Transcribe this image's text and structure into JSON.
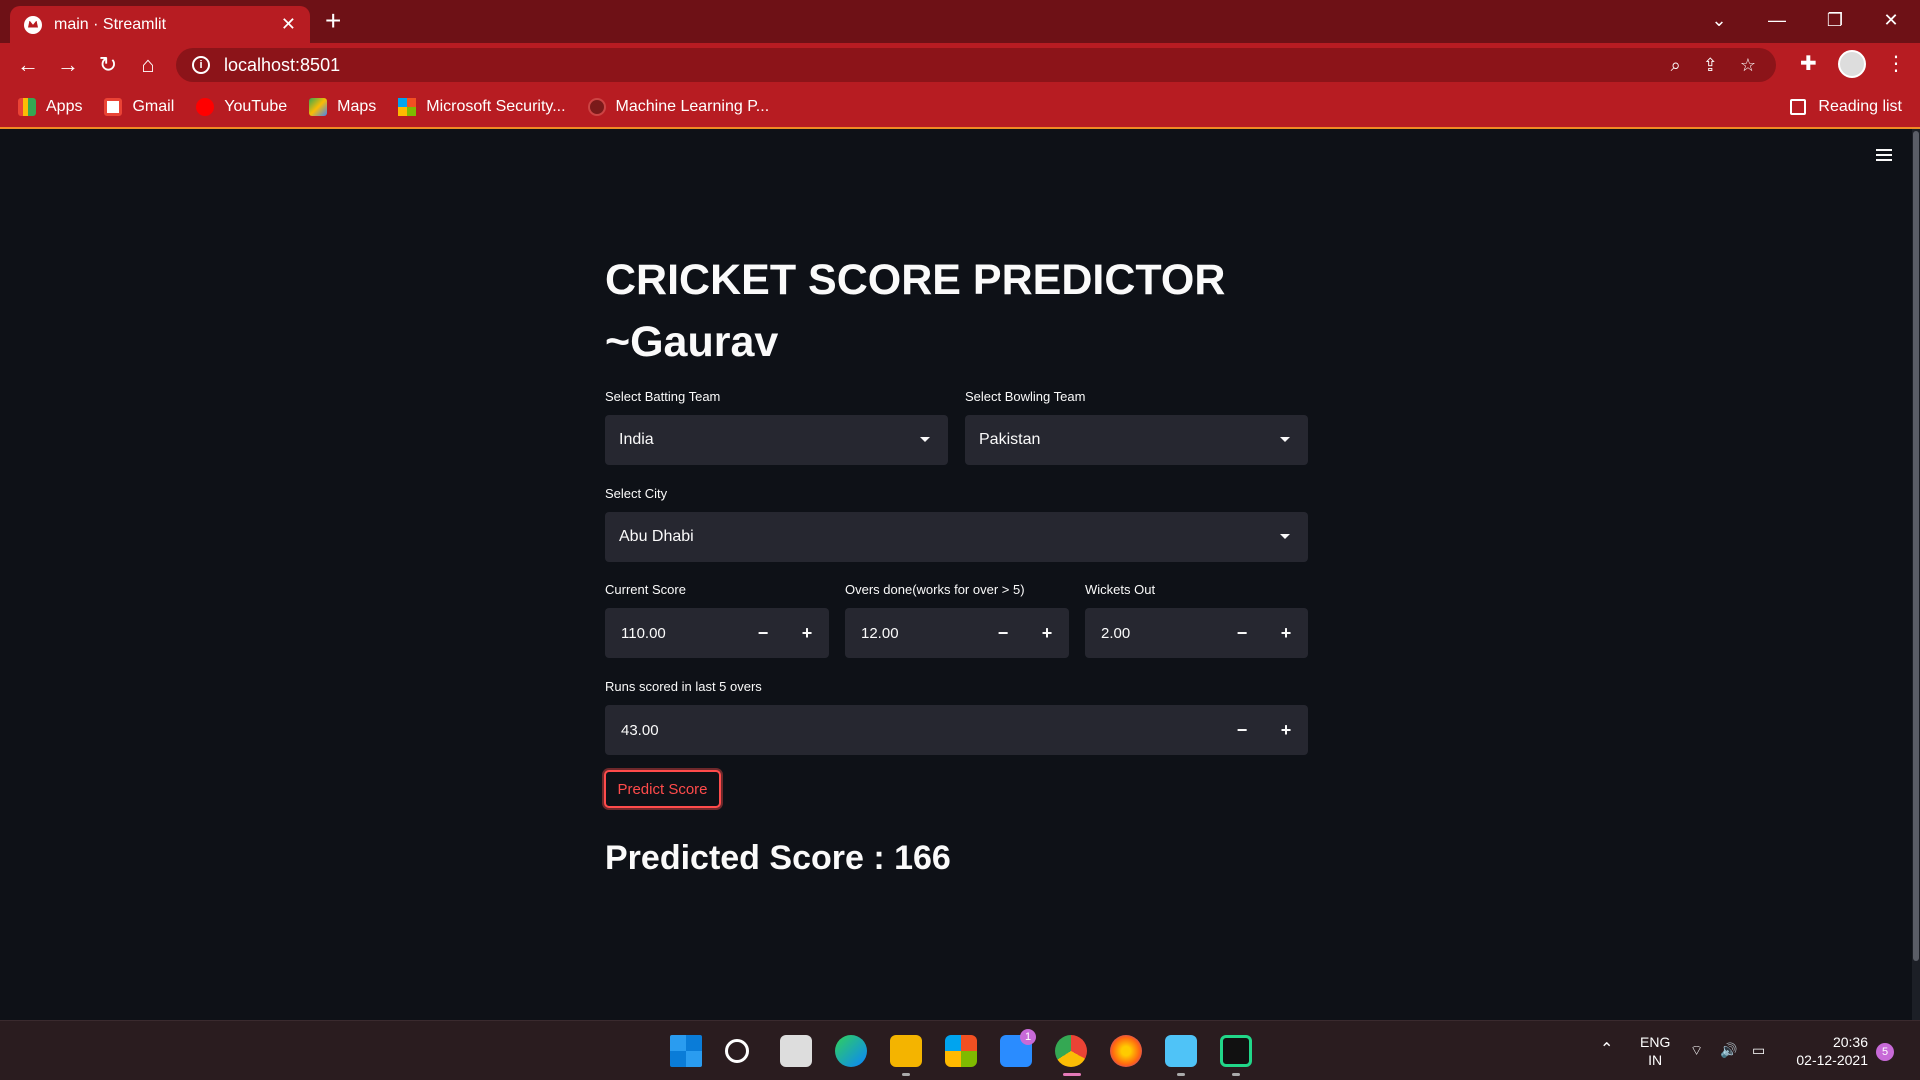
{
  "browser": {
    "tab_title": "main · Streamlit",
    "url": "localhost:8501",
    "bookmarks": [
      "Apps",
      "Gmail",
      "YouTube",
      "Maps",
      "Microsoft Security...",
      "Machine Learning P..."
    ],
    "reading_list": "Reading list"
  },
  "app": {
    "title_line1": "CRICKET SCORE PREDICTOR",
    "title_line2": "~Gaurav",
    "batting": {
      "label": "Select Batting Team",
      "value": "India"
    },
    "bowling": {
      "label": "Select Bowling Team",
      "value": "Pakistan"
    },
    "city": {
      "label": "Select City",
      "value": "Abu Dhabi"
    },
    "current_score": {
      "label": "Current Score",
      "value": "110.00"
    },
    "overs": {
      "label": "Overs done(works for over > 5)",
      "value": "12.00"
    },
    "wickets": {
      "label": "Wickets Out",
      "value": "2.00"
    },
    "last_five": {
      "label": "Runs scored in last 5 overs",
      "value": "43.00"
    },
    "predict_button": "Predict Score",
    "result": "Predicted Score : 166",
    "minus": "−",
    "plus": "+"
  },
  "taskbar": {
    "lang1": "ENG",
    "lang2": "IN",
    "time": "20:36",
    "date": "02-12-2021",
    "mail_badge": "1",
    "notif_count": "5"
  },
  "colors": {
    "accent": "#ff4b4b",
    "chrome": "#b71c22",
    "bg": "#0e1117",
    "input": "#262730"
  }
}
